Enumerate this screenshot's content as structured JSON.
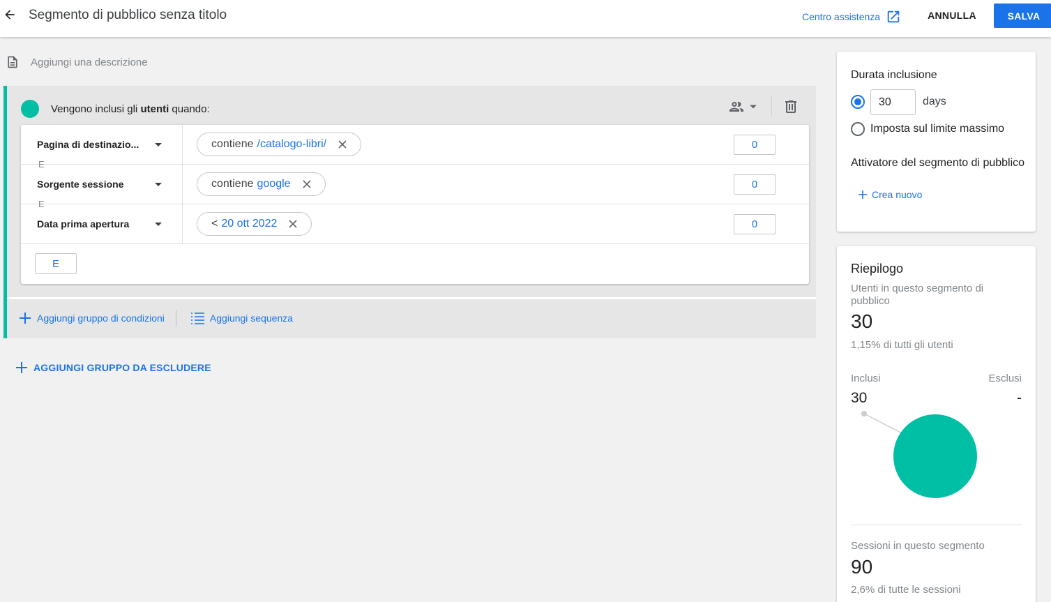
{
  "header": {
    "title": "Segmento di pubblico senza titolo",
    "help_label": "Centro assistenza",
    "cancel_label": "ANNULLA",
    "save_label": "SALVA"
  },
  "description": {
    "placeholder": "Aggiungi una descrizione"
  },
  "group": {
    "header_prefix": "Vengono inclusi gli ",
    "header_bold": "utenti",
    "header_suffix": " quando:",
    "conditions": [
      {
        "dimension": "Pagina di destinazio...",
        "operator": "contiene",
        "value": "/catalogo-libri/",
        "count": "0"
      },
      {
        "dimension": "Sorgente sessione",
        "operator": "contiene",
        "value": "google",
        "count": "0"
      },
      {
        "dimension": "Data prima apertura",
        "operator": "<",
        "value": "20 ott 2022",
        "count": "0"
      }
    ],
    "and_label": "E",
    "and_button": "E",
    "add_condition_group": "Aggiungi gruppo di condizioni",
    "add_sequence": "Aggiungi sequenza"
  },
  "add_exclude_group": "AGGIUNGI GRUPPO DA ESCLUDERE",
  "duration": {
    "title": "Durata inclusione",
    "days_value": "30",
    "days_unit": "days",
    "max_limit_label": "Imposta sul limite massimo",
    "trigger_title": "Attivatore del segmento di pubblico",
    "create_new": "Crea nuovo"
  },
  "summary": {
    "title": "Riepilogo",
    "users_label": "Utenti in questo segmento di pubblico",
    "users_value": "30",
    "users_pct": "1,15% di tutti gli utenti",
    "included_label": "Inclusi",
    "excluded_label": "Esclusi",
    "included_value": "30",
    "excluded_value": "-",
    "sessions_label": "Sessioni in questo segmento",
    "sessions_value": "90",
    "sessions_pct": "2,6% di tutte le sessioni"
  },
  "colors": {
    "accent": "#1a73e8",
    "segment": "#00bfa5"
  },
  "icons": [
    "back-arrow-icon",
    "external-link-icon",
    "document-icon",
    "people-icon",
    "caret-down-icon",
    "trash-icon",
    "close-icon",
    "plus-icon",
    "list-icon"
  ]
}
